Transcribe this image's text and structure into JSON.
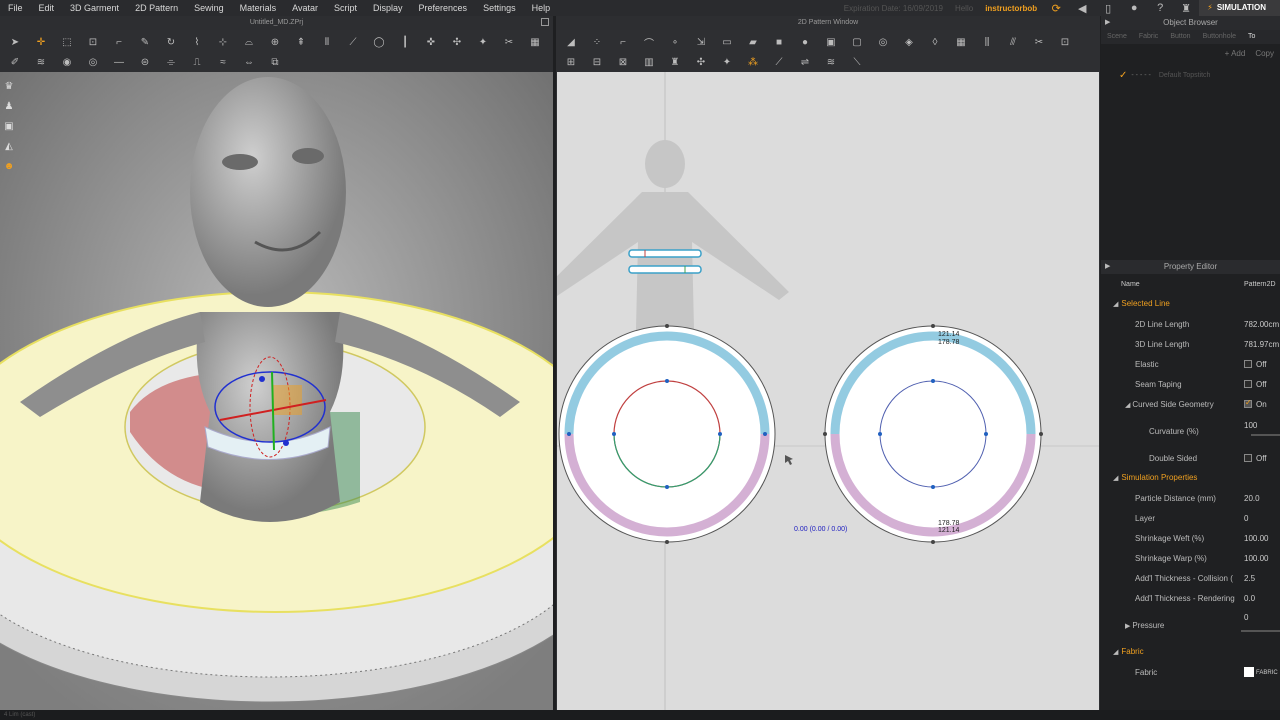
{
  "menubar": {
    "items": [
      "File",
      "Edit",
      "3D Garment",
      "2D Pattern",
      "Sewing",
      "Materials",
      "Avatar",
      "Script",
      "Display",
      "Preferences",
      "Settings",
      "Help"
    ],
    "expiration": "Expiration Date: 16/09/2019",
    "hello": "Hello",
    "user": "instructorbob",
    "sim_label": "SIMULATION"
  },
  "win3d": {
    "title": "Untitled_MD.ZPrj"
  },
  "win2d": {
    "title": "2D Pattern Window",
    "coord_readout": "0.00 (0.00 / 0.00)"
  },
  "measurements": {
    "right_top_a": "121.14",
    "right_top_b": "178.78",
    "right_bot_a": "178.78",
    "right_bot_b": "121.14"
  },
  "object_browser": {
    "title": "Object Browser",
    "tabs": [
      "Scene",
      "Fabric",
      "Button",
      "Buttonhole",
      "To"
    ],
    "add_label": "+ Add",
    "copy_label": "Copy",
    "item": "Default Topstitch"
  },
  "property_editor": {
    "title": "Property Editor",
    "name_label": "Name",
    "name_value": "Pattern2D",
    "selected_line": "Selected Line",
    "rows_line": [
      {
        "label": "2D Line Length",
        "value": "782.00cm"
      },
      {
        "label": "3D Line Length",
        "value": "781.97cm"
      }
    ],
    "elastic": {
      "label": "Elastic",
      "value": "Off"
    },
    "seam_taping": {
      "label": "Seam Taping",
      "value": "Off"
    },
    "curved": {
      "label": "Curved Side Geometry",
      "value": "On"
    },
    "curvature": {
      "label": "Curvature (%)",
      "value": "100"
    },
    "double_sided": {
      "label": "Double Sided",
      "value": "Off"
    },
    "sim_props": "Simulation Properties",
    "rows_sim": [
      {
        "label": "Particle Distance (mm)",
        "value": "20.0"
      },
      {
        "label": "Layer",
        "value": "0"
      },
      {
        "label": "Shrinkage Weft (%)",
        "value": "100.00"
      },
      {
        "label": "Shrinkage Warp (%)",
        "value": "100.00"
      },
      {
        "label": "Add'l Thickness - Collision (",
        "value": "2.5"
      },
      {
        "label": "Add'l Thickness - Rendering",
        "value": "0.0"
      }
    ],
    "pressure": {
      "label": "Pressure",
      "value": "0"
    },
    "fabric_section": "Fabric",
    "fabric_row": {
      "label": "Fabric",
      "value": "FABRIC"
    }
  },
  "statusbar": {
    "text": "4 Lim (cast)"
  },
  "colors": {
    "accent": "#f0a020",
    "seam_blue": "#3aa0c8",
    "seam_purple": "#a050a0"
  }
}
